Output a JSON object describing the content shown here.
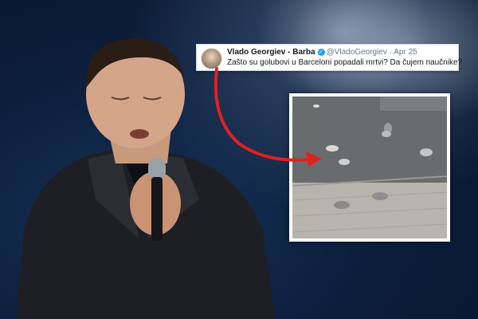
{
  "tweet": {
    "name": "Vlado Georgiev - Barba",
    "handle": "@VladoGeorgiev",
    "separator": "·",
    "date": "Apr 25",
    "text": "Zašto su golubovi u Barceloni popadali mrtvi? Da čujem naučnike?",
    "verified_icon": "verified-badge-icon",
    "verified_symbol": "✓"
  },
  "colors": {
    "background": "#0b1a33",
    "arrow": "#e02020",
    "verified": "#1da1f2"
  }
}
